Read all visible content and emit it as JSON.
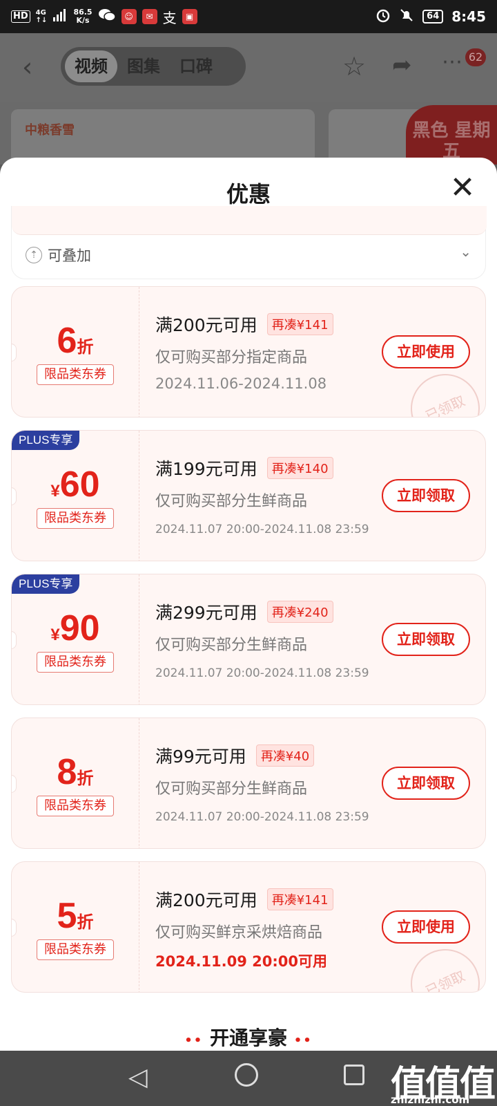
{
  "status_bar": {
    "hd": "HD",
    "network_top": "4G",
    "network_bottom": "↑↓",
    "speed_value": "86.5",
    "speed_unit": "K/s",
    "battery": "64",
    "time": "8:45"
  },
  "header": {
    "tabs": [
      "视频",
      "图集",
      "口碑"
    ],
    "active_tab": "视频",
    "more_badge": "62"
  },
  "banner": {
    "brand_text": "中粮香雪",
    "ribbon_text": "黑色 星期五"
  },
  "sheet": {
    "title": "优惠",
    "stack_label": "可叠加"
  },
  "coupons": [
    {
      "plus": "",
      "value": "6",
      "unit": "折",
      "prefix": "",
      "tag": "限品类东券",
      "title": "满200元可用",
      "need": "再凑¥141",
      "desc": "仅可购买部分指定商品",
      "date": "2024.11.06-2024.11.08",
      "button": "立即使用",
      "stamp": "已领取"
    },
    {
      "plus": "PLUS专享",
      "value": "60",
      "unit": "",
      "prefix": "¥",
      "tag": "限品类东券",
      "title": "满199元可用",
      "need": "再凑¥140",
      "desc": "仅可购买部分生鲜商品",
      "date": "2024.11.07 20:00-2024.11.08 23:59",
      "button": "立即领取",
      "stamp": ""
    },
    {
      "plus": "PLUS专享",
      "value": "90",
      "unit": "",
      "prefix": "¥",
      "tag": "限品类东券",
      "title": "满299元可用",
      "need": "再凑¥240",
      "desc": "仅可购买部分生鲜商品",
      "date": "2024.11.07 20:00-2024.11.08 23:59",
      "button": "立即领取",
      "stamp": ""
    },
    {
      "plus": "",
      "value": "8",
      "unit": "折",
      "prefix": "",
      "tag": "限品类东券",
      "title": "满99元可用",
      "need": "再凑¥40",
      "desc": "仅可购买部分生鲜商品",
      "date": "2024.11.07 20:00-2024.11.08 23:59",
      "button": "立即领取",
      "stamp": ""
    },
    {
      "plus": "",
      "value": "5",
      "unit": "折",
      "prefix": "",
      "tag": "限品类东券",
      "title": "满200元可用",
      "need": "再凑¥141",
      "desc": "仅可购买鲜京采烘焙商品",
      "date": "2024.11.09 20:00可用",
      "button": "立即使用",
      "stamp": "已领取"
    }
  ],
  "section_heading": "开通享豪",
  "watermark": {
    "main": "值值值",
    "sub": "zhizhizhi.com"
  },
  "colors": {
    "accent": "#e2231a",
    "plus_badge": "#2c3f9f",
    "coupon_bg": "#fff6f4"
  }
}
